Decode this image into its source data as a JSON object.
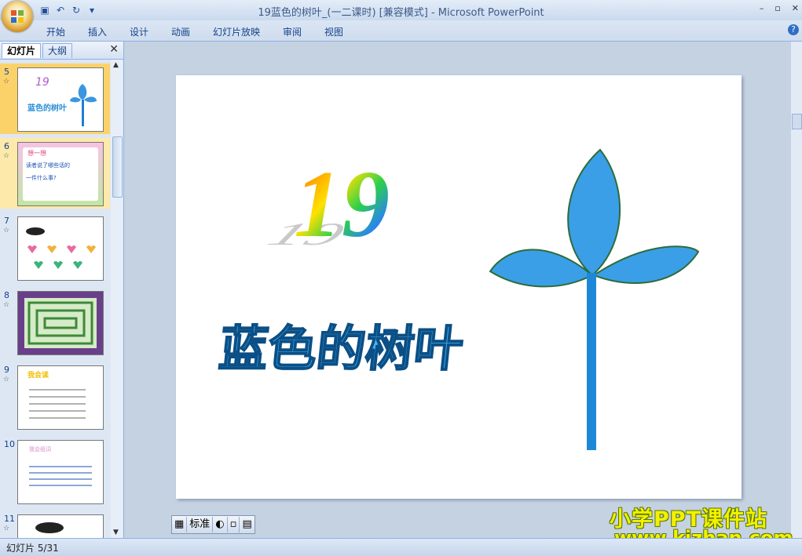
{
  "window": {
    "title": "19蓝色的树叶_(一二课时) [兼容模式] - Microsoft PowerPoint",
    "controls": [
      "–",
      "▫",
      "✕"
    ]
  },
  "ribbon": {
    "tabs": [
      "开始",
      "插入",
      "设计",
      "动画",
      "幻灯片放映",
      "审阅",
      "视图"
    ],
    "help": "?"
  },
  "left_pane": {
    "tab_slides": "幻灯片",
    "tab_outline": "大纲",
    "close": "✕",
    "thumbnails": [
      {
        "num": "5",
        "title": "19",
        "caption": "蓝色的树叶",
        "selected": true
      },
      {
        "num": "6",
        "title": "想一想",
        "lines": [
          "读者说了哪些话的",
          "一件什么事?"
        ]
      },
      {
        "num": "7"
      },
      {
        "num": "8"
      },
      {
        "num": "9",
        "title": "我会读"
      },
      {
        "num": "10",
        "title": "我会组词"
      },
      {
        "num": "11"
      }
    ],
    "star": "☆"
  },
  "slide": {
    "number_text": "19",
    "title_text": "蓝色的树叶",
    "colors": {
      "title": "#42b0ee",
      "leaf": "#2f8fe0",
      "stem": "#1e7fd4"
    }
  },
  "view_bar": {
    "label": "标准"
  },
  "status": {
    "text": "幻灯片 5/31"
  },
  "watermark": {
    "line1": "小学PPT课件站",
    "line2": "www.kjzhan.com"
  }
}
